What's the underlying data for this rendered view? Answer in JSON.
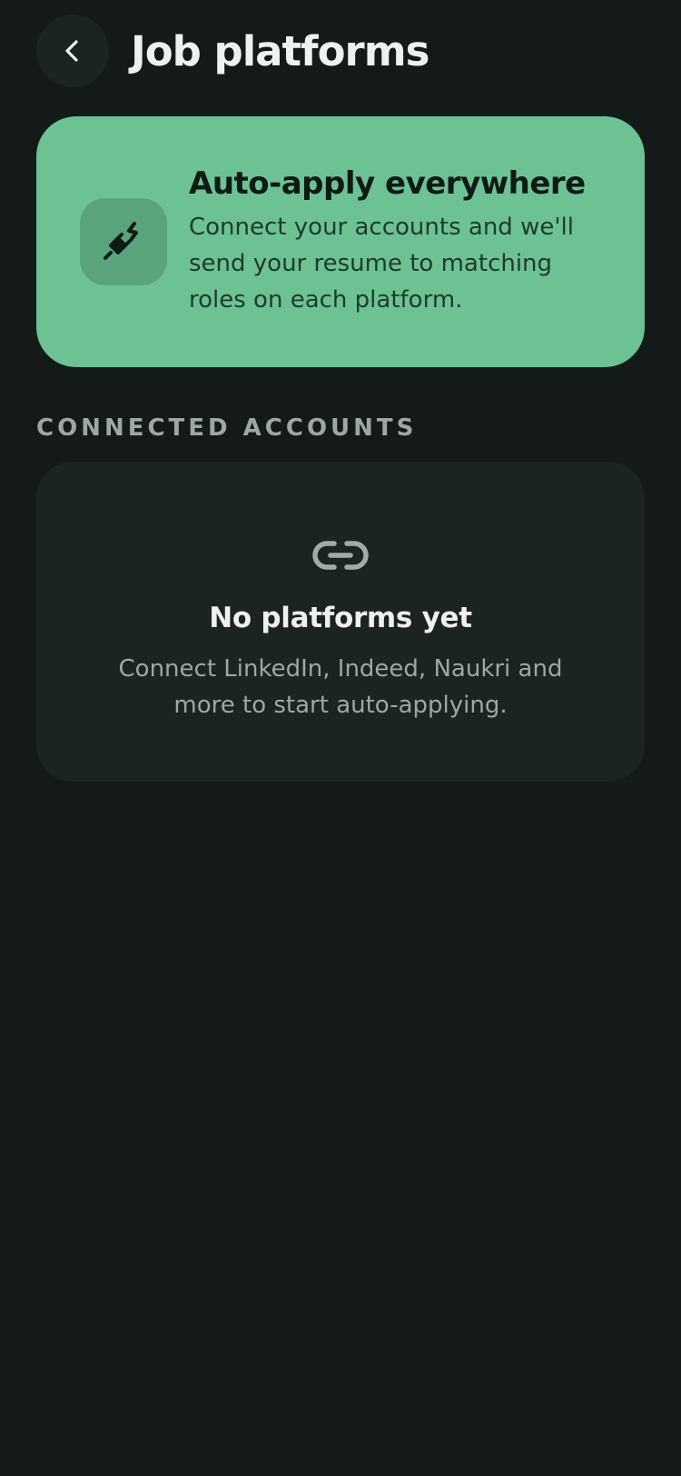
{
  "header": {
    "back_icon": "chevron-left-icon",
    "title": "Job platforms"
  },
  "hero": {
    "icon": "plug-icon",
    "title": "Auto-apply everywhere",
    "description": "Connect your accounts and we'll send your resume to matching roles on each platform."
  },
  "connected_accounts": {
    "label": "CONNECTED ACCOUNTS",
    "empty_state": {
      "icon": "link-icon",
      "title": "No platforms yet",
      "description": "Connect LinkedIn, Indeed, Naukri and more to start auto-applying."
    }
  },
  "colors": {
    "background": "#131a17",
    "card": "#1c2420",
    "accent_green": "#6cc293",
    "muted_text": "#9ea7a2"
  }
}
